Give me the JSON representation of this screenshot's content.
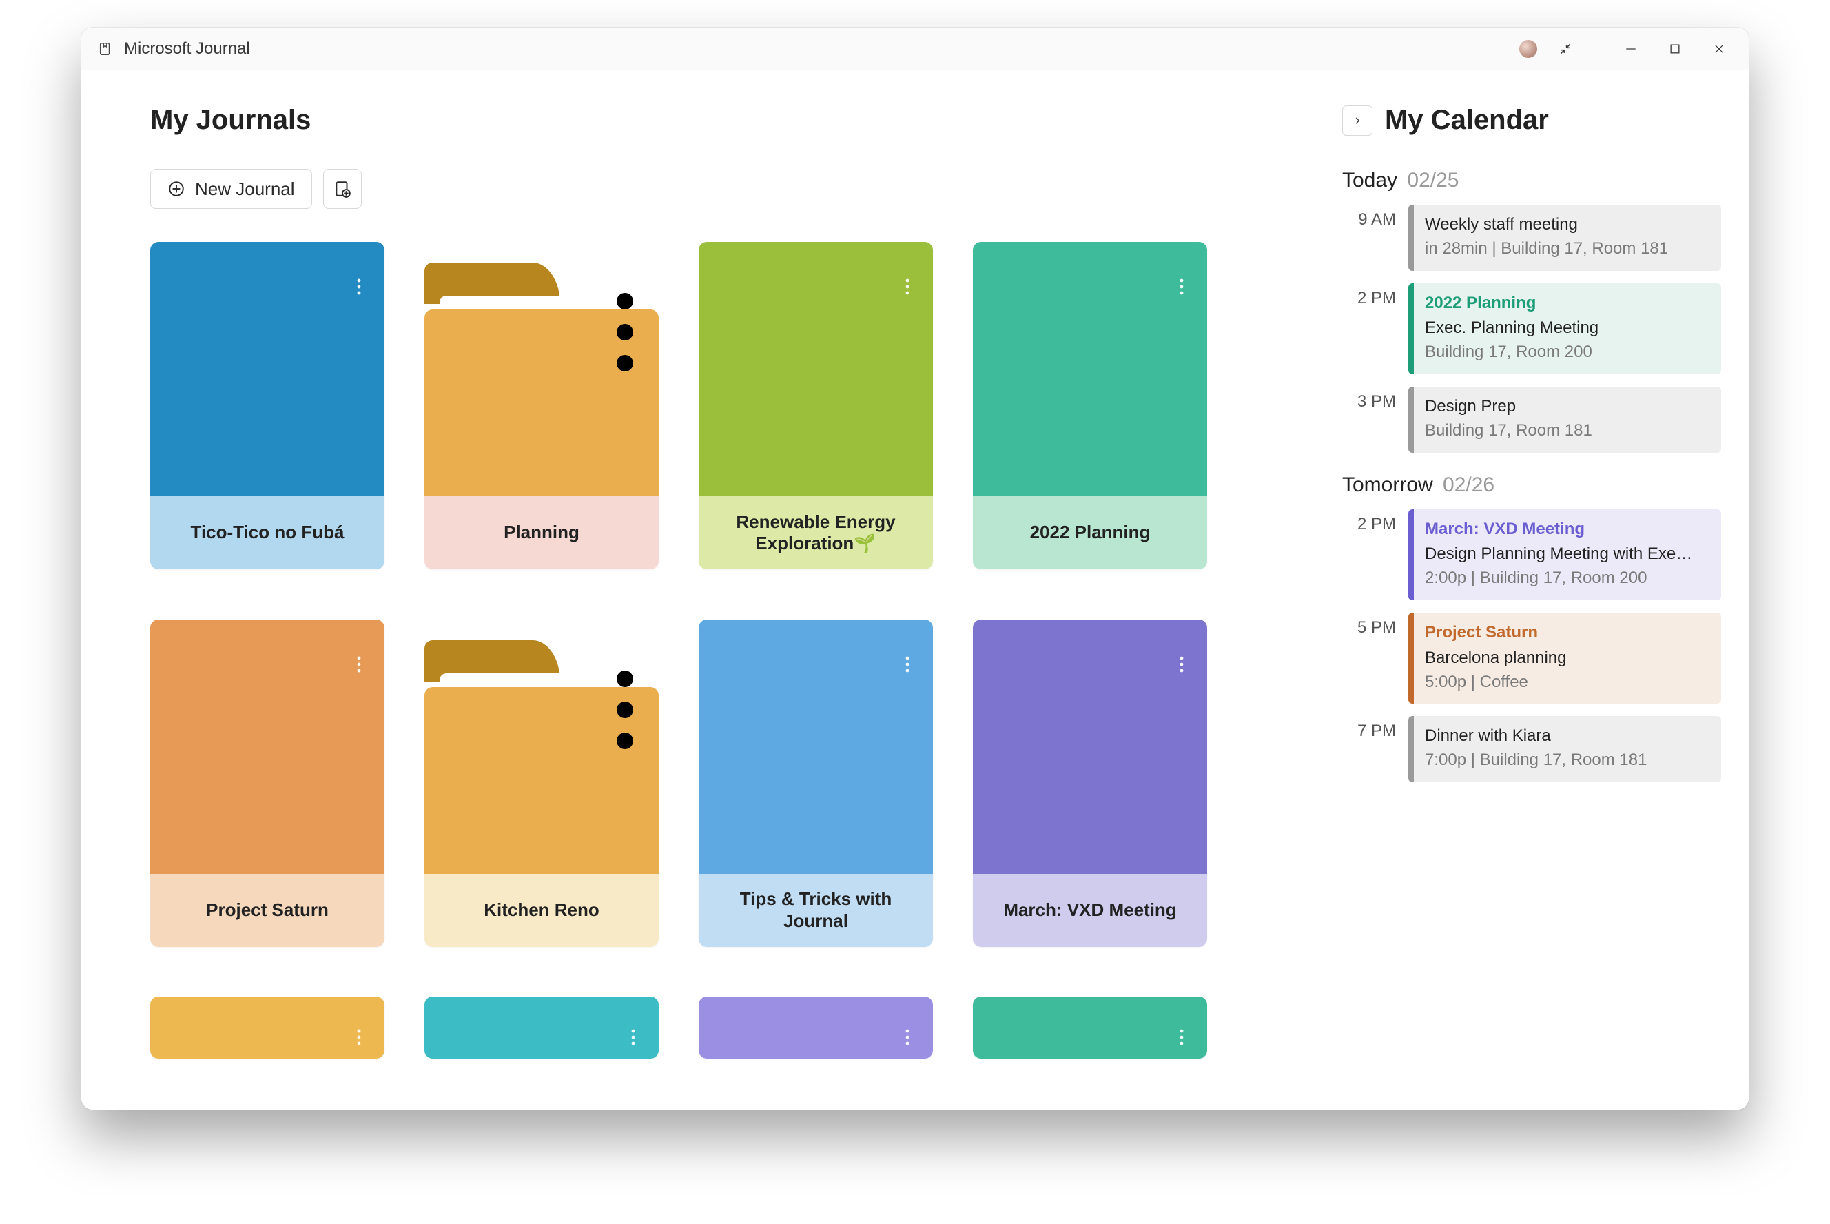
{
  "app": {
    "title": "Microsoft Journal"
  },
  "main": {
    "heading": "My Journals",
    "new_journal_label": "New Journal"
  },
  "journals": [
    {
      "title": "Tico-Tico no Fubá",
      "type": "journal",
      "cover": "#248ac2",
      "footer": "#b1d8ef"
    },
    {
      "title": "Planning",
      "type": "folder",
      "folder_front": "#eaae4e",
      "folder_tab": "#b8861e",
      "footer": "#f7d9d3"
    },
    {
      "title": "Renewable Energy Exploration🌱",
      "type": "journal",
      "cover": "#9bbe3b",
      "footer": "#dce9a7"
    },
    {
      "title": "2022 Planning",
      "type": "journal",
      "cover": "#3dbb9a",
      "footer": "#b8e6d1"
    },
    {
      "title": "Project Saturn",
      "type": "journal",
      "cover": "#e69a55",
      "footer": "#f6d9bd"
    },
    {
      "title": "Kitchen Reno",
      "type": "folder",
      "folder_front": "#eaae4e",
      "folder_tab": "#b8861e",
      "footer": "#f8eac6"
    },
    {
      "title": "Tips & Tricks with Journal",
      "type": "journal",
      "cover": "#5ea9e1",
      "footer": "#c0ddf3"
    },
    {
      "title": "March: VXD Meeting",
      "type": "journal",
      "cover": "#7c74ce",
      "footer": "#d0ccee"
    },
    {
      "title": "",
      "type": "journal",
      "cover": "#ecb84f",
      "footer": "#ffffff"
    },
    {
      "title": "",
      "type": "journal",
      "cover": "#3cbcc4",
      "footer": "#ffffff"
    },
    {
      "title": "",
      "type": "journal",
      "cover": "#9a8fe3",
      "footer": "#ffffff"
    },
    {
      "title": "",
      "type": "journal",
      "cover": "#3dbb9a",
      "footer": "#ffffff"
    }
  ],
  "calendar": {
    "heading": "My Calendar",
    "days": [
      {
        "label": "Today",
        "date": "02/25",
        "events": [
          {
            "time": "9 AM",
            "category": "",
            "title": "Weekly staff meeting",
            "subtitle": "in 28min | Building 17, Room 181",
            "bar": "#9a9a9a",
            "bg": "#eeeeee",
            "cat_color": "#000"
          },
          {
            "time": "2 PM",
            "category": "2022 Planning",
            "title": "Exec. Planning Meeting",
            "subtitle": "Building 17, Room 200",
            "bar": "#1e9e78",
            "bg": "#e6f3ee",
            "cat_color": "#1e9e78"
          },
          {
            "time": "3 PM",
            "category": "",
            "title": "Design Prep",
            "subtitle": "Building 17, Room 181",
            "bar": "#9a9a9a",
            "bg": "#eeeeee",
            "cat_color": "#000"
          }
        ]
      },
      {
        "label": "Tomorrow",
        "date": "02/26",
        "events": [
          {
            "time": "2 PM",
            "category": "March: VXD Meeting",
            "title": "Design Planning Meeting with Exe…",
            "subtitle": "2:00p | Building 17, Room 200",
            "bar": "#6a5ed1",
            "bg": "#eceaf8",
            "cat_color": "#6a5ed1"
          },
          {
            "time": "5 PM",
            "category": "Project Saturn",
            "title": "Barcelona planning",
            "subtitle": "5:00p | Coffee",
            "bar": "#c26a2e",
            "bg": "#f7ece3",
            "cat_color": "#c26a2e"
          },
          {
            "time": "7 PM",
            "category": "",
            "title": "Dinner with Kiara",
            "subtitle": "7:00p | Building 17, Room 181",
            "bar": "#9a9a9a",
            "bg": "#eeeeee",
            "cat_color": "#000"
          }
        ]
      }
    ]
  }
}
